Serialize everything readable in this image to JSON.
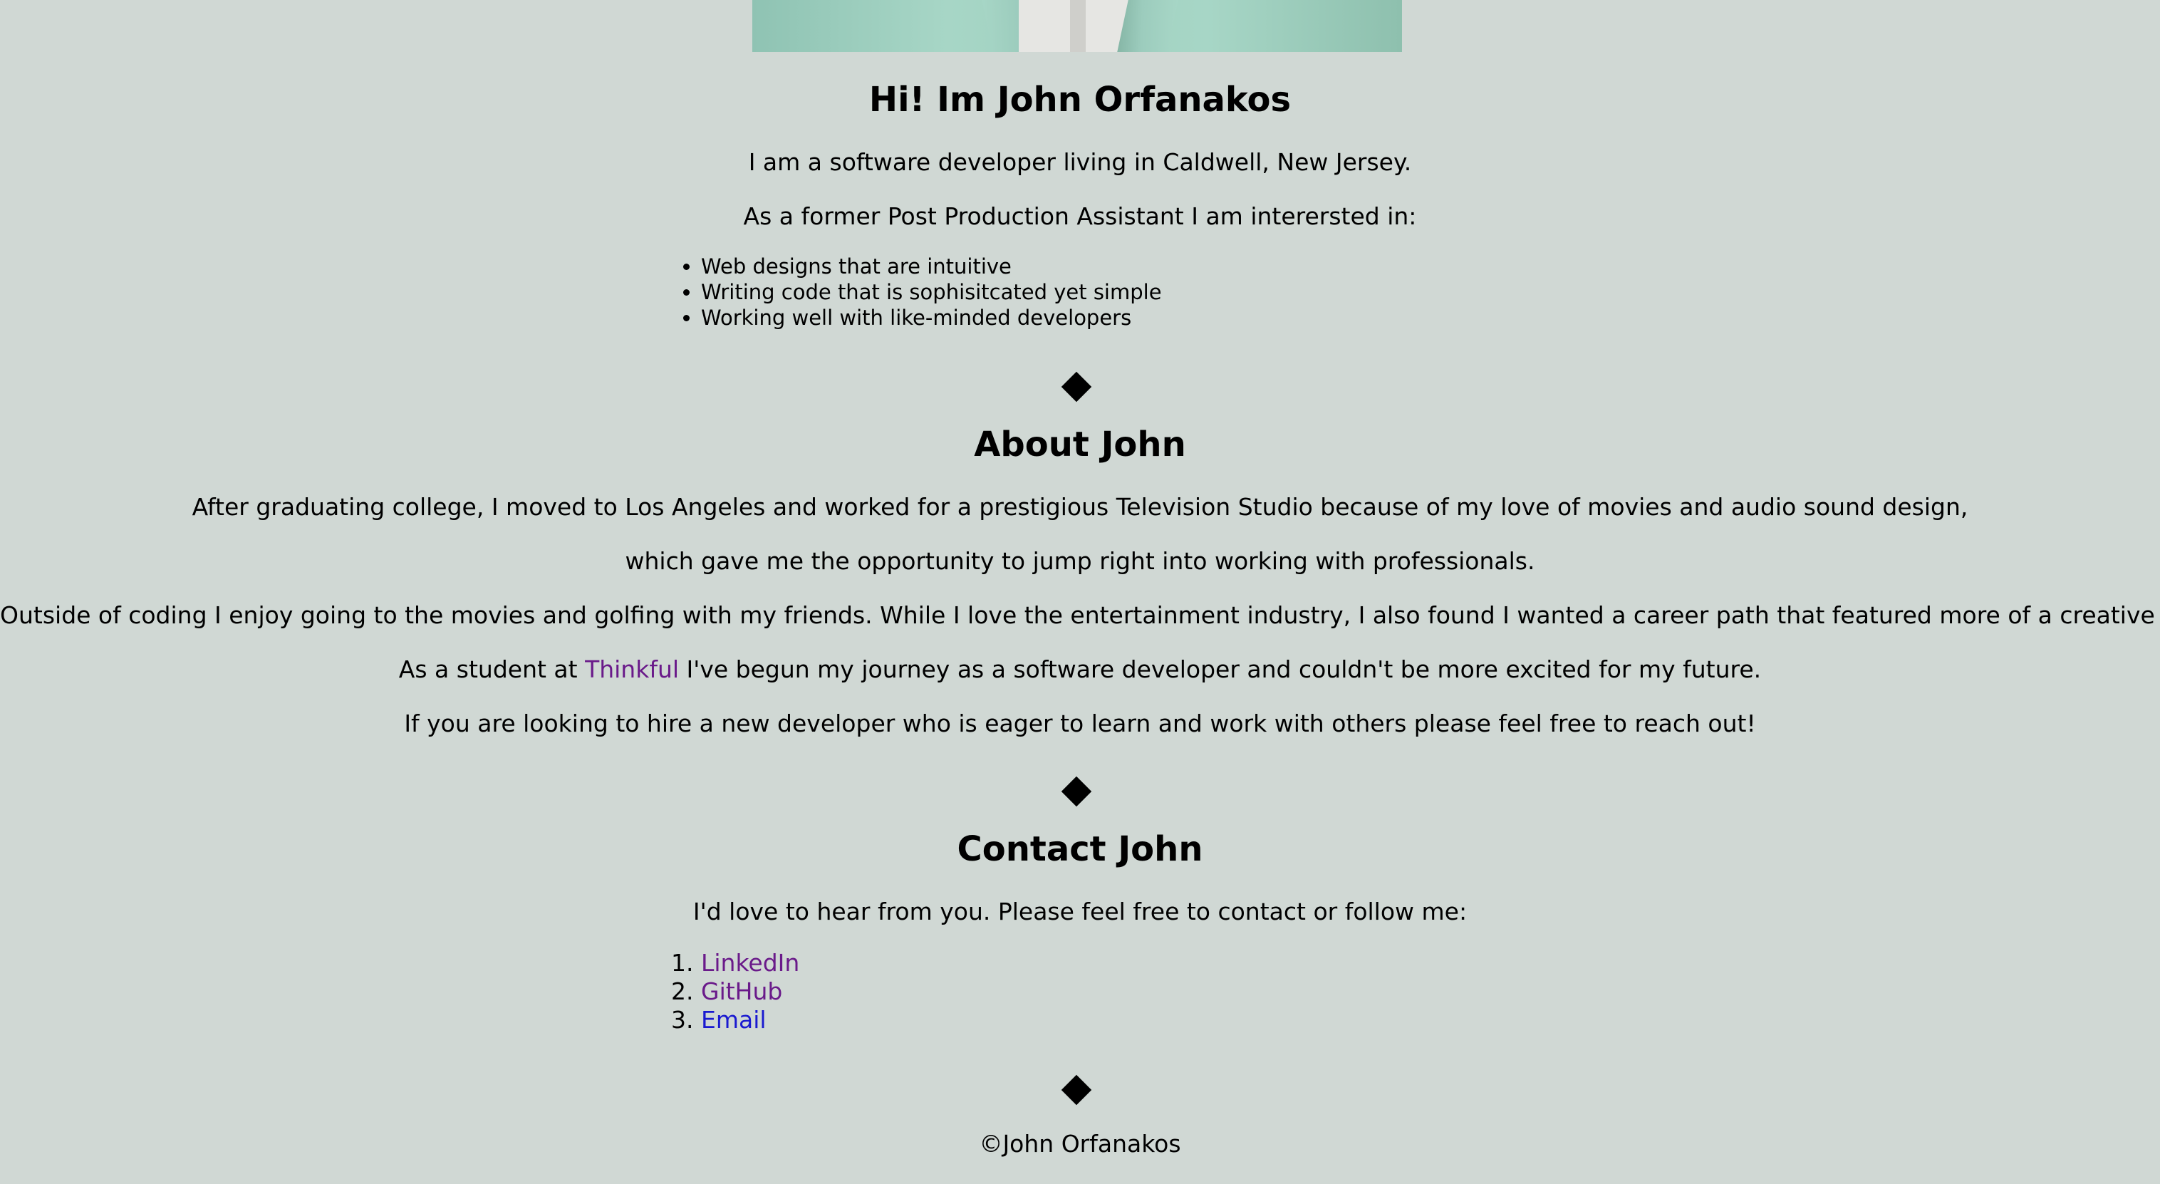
{
  "hero": {
    "title": "Hi! Im John Orfanakos",
    "intro": "I am a software developer living in Caldwell, New Jersey.",
    "interest_lead": "As a former Post Production Assistant I am interersted in:",
    "interests": [
      "Web designs that are intuitive",
      "Writing code that is sophisitcated yet simple",
      "Working well with like-minded developers"
    ]
  },
  "about": {
    "title": "About John",
    "paragraph_1": "After graduating college, I moved to Los Angeles and worked for a prestigious Television Studio because of my love of movies and audio sound design,",
    "paragraph_2": "which gave me the opportunity to jump right into working with professionals.",
    "paragraph_3": "Outside of coding I enjoy going to the movies and golfing with my friends. While I love the entertainment industry, I also found I wanted a career path that featured more of a creative side.",
    "student_before": "As a student at ",
    "student_link": "Thinkful",
    "student_after": " I've begun my journey as a software developer and couldn't be more excited for my future.",
    "paragraph_5": "If you are looking to hire a new developer who is eager to learn and work with others please feel free to reach out!"
  },
  "contact": {
    "title": "Contact John",
    "lead": "I'd love to hear from you. Please feel free to contact or follow me:",
    "links": [
      "LinkedIn",
      "GitHub",
      "Email"
    ]
  },
  "footer": {
    "copyright": "©John Orfanakos"
  },
  "colors": {
    "background": "#d0d8d4",
    "visited_link": "#6a1a8a",
    "unvisited_link": "#1a1ad0"
  }
}
